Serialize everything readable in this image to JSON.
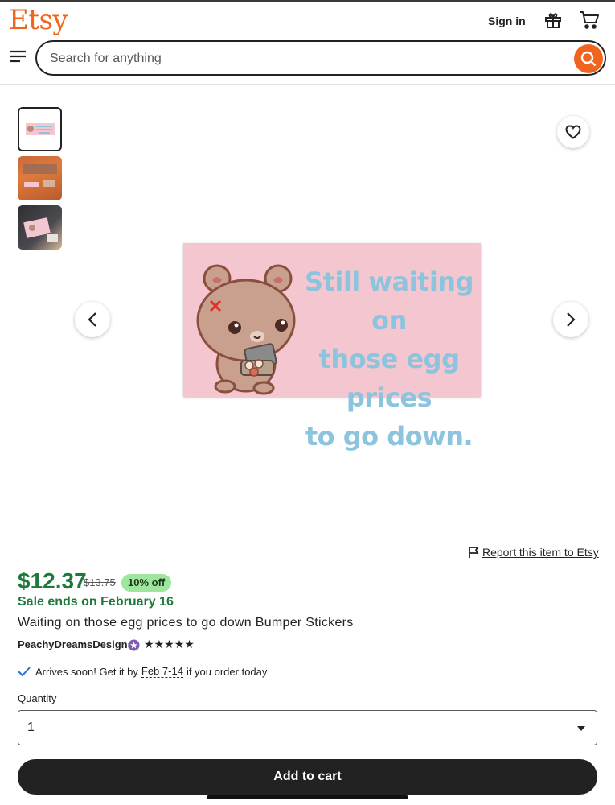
{
  "header": {
    "logo": "Etsy",
    "sign_in": "Sign in",
    "search_placeholder": "Search for anything"
  },
  "icons": {
    "menu": "hamburger-menu-icon",
    "gift": "gift-icon",
    "cart": "shopping-cart-icon",
    "search": "search-icon",
    "favorite": "heart-icon",
    "prev": "chevron-left-icon",
    "next": "chevron-right-icon",
    "report": "flag-icon",
    "delivery": "checkmark-icon",
    "star_seller": "star-seller-badge-icon"
  },
  "gallery": {
    "thumbnail_count": 3,
    "selected_index": 0,
    "sticker_text": [
      "Still waiting on",
      "those egg prices",
      "to go down."
    ]
  },
  "report_link": "Report this item to Etsy",
  "listing": {
    "price": "$12.37",
    "original_price": "$13.75",
    "discount": "10% off",
    "sale_ends": "Sale ends on February 16",
    "title": "Waiting on those egg prices to go down Bumper Stickers",
    "shop_name": "PeachyDreamsDesigns",
    "rating_stars": 5
  },
  "delivery": {
    "prefix": "Arrives soon! Get it by",
    "dates": "Feb 7-14",
    "suffix": "if you order today"
  },
  "quantity": {
    "label": "Quantity",
    "selected": "1"
  },
  "add_to_cart": "Add to cart",
  "colors": {
    "brand": "#f1641e",
    "price_green": "#1e7a3c",
    "discount_badge": "#9ee69e",
    "sticker_bg": "#f4c6cf",
    "sticker_text": "#8cc4de"
  }
}
